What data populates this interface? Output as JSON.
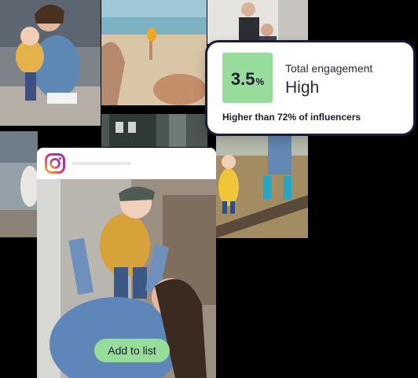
{
  "engagement": {
    "score": "3.5",
    "unit": "%",
    "label": "Total engagement",
    "level": "High",
    "comparison": "Higher than 72% of influencers"
  },
  "post": {
    "platform_icon": "instagram-icon",
    "add_button_label": "Add to list"
  },
  "colors": {
    "accent_green": "#97dc9a",
    "card_border": "#1b1b3a",
    "text_dark": "#1c1c2c"
  }
}
